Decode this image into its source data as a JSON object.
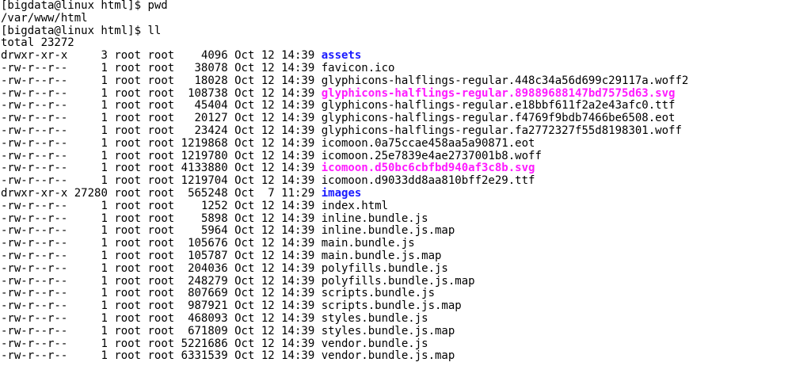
{
  "colors": {
    "background": "#ffffff",
    "text": "#000000",
    "directory": "#1a1aff",
    "svg_file": "#ff1aff"
  },
  "terminal": {
    "prompt_1": "[bigdata@linux html]$ ",
    "command_1": "pwd",
    "output_pwd": "/var/www/html",
    "prompt_2": "[bigdata@linux html]$ ",
    "command_2": "ll",
    "total": "total 23272",
    "entries": [
      {
        "perms": "drwxr-xr-x",
        "links": "3",
        "owner": "root",
        "group": "root",
        "size": "4096",
        "month": "Oct",
        "day": "12",
        "time": "14:39",
        "name": "assets",
        "type": "dir"
      },
      {
        "perms": "-rw-r--r--",
        "links": "1",
        "owner": "root",
        "group": "root",
        "size": "38078",
        "month": "Oct",
        "day": "12",
        "time": "14:39",
        "name": "favicon.ico",
        "type": "regular"
      },
      {
        "perms": "-rw-r--r--",
        "links": "1",
        "owner": "root",
        "group": "root",
        "size": "18028",
        "month": "Oct",
        "day": "12",
        "time": "14:39",
        "name": "glyphicons-halflings-regular.448c34a56d699c29117a.woff2",
        "type": "regular"
      },
      {
        "perms": "-rw-r--r--",
        "links": "1",
        "owner": "root",
        "group": "root",
        "size": "108738",
        "month": "Oct",
        "day": "12",
        "time": "14:39",
        "name": "glyphicons-halflings-regular.89889688147bd7575d63.svg",
        "type": "svg"
      },
      {
        "perms": "-rw-r--r--",
        "links": "1",
        "owner": "root",
        "group": "root",
        "size": "45404",
        "month": "Oct",
        "day": "12",
        "time": "14:39",
        "name": "glyphicons-halflings-regular.e18bbf611f2a2e43afc0.ttf",
        "type": "regular"
      },
      {
        "perms": "-rw-r--r--",
        "links": "1",
        "owner": "root",
        "group": "root",
        "size": "20127",
        "month": "Oct",
        "day": "12",
        "time": "14:39",
        "name": "glyphicons-halflings-regular.f4769f9bdb7466be6508.eot",
        "type": "regular"
      },
      {
        "perms": "-rw-r--r--",
        "links": "1",
        "owner": "root",
        "group": "root",
        "size": "23424",
        "month": "Oct",
        "day": "12",
        "time": "14:39",
        "name": "glyphicons-halflings-regular.fa2772327f55d8198301.woff",
        "type": "regular"
      },
      {
        "perms": "-rw-r--r--",
        "links": "1",
        "owner": "root",
        "group": "root",
        "size": "1219868",
        "month": "Oct",
        "day": "12",
        "time": "14:39",
        "name": "icomoon.0a75ccae458aa5a90871.eot",
        "type": "regular"
      },
      {
        "perms": "-rw-r--r--",
        "links": "1",
        "owner": "root",
        "group": "root",
        "size": "1219780",
        "month": "Oct",
        "day": "12",
        "time": "14:39",
        "name": "icomoon.25e7839e4ae2737001b8.woff",
        "type": "regular"
      },
      {
        "perms": "-rw-r--r--",
        "links": "1",
        "owner": "root",
        "group": "root",
        "size": "4133880",
        "month": "Oct",
        "day": "12",
        "time": "14:39",
        "name": "icomoon.d50bc6cbfbd940af3c8b.svg",
        "type": "svg"
      },
      {
        "perms": "-rw-r--r--",
        "links": "1",
        "owner": "root",
        "group": "root",
        "size": "1219704",
        "month": "Oct",
        "day": "12",
        "time": "14:39",
        "name": "icomoon.d9033dd8aa810bff2e29.ttf",
        "type": "regular"
      },
      {
        "perms": "drwxr-xr-x",
        "links": "27280",
        "owner": "root",
        "group": "root",
        "size": "565248",
        "month": "Oct",
        "day": "7",
        "time": "11:29",
        "name": "images",
        "type": "dir"
      },
      {
        "perms": "-rw-r--r--",
        "links": "1",
        "owner": "root",
        "group": "root",
        "size": "1252",
        "month": "Oct",
        "day": "12",
        "time": "14:39",
        "name": "index.html",
        "type": "regular"
      },
      {
        "perms": "-rw-r--r--",
        "links": "1",
        "owner": "root",
        "group": "root",
        "size": "5898",
        "month": "Oct",
        "day": "12",
        "time": "14:39",
        "name": "inline.bundle.js",
        "type": "regular"
      },
      {
        "perms": "-rw-r--r--",
        "links": "1",
        "owner": "root",
        "group": "root",
        "size": "5964",
        "month": "Oct",
        "day": "12",
        "time": "14:39",
        "name": "inline.bundle.js.map",
        "type": "regular"
      },
      {
        "perms": "-rw-r--r--",
        "links": "1",
        "owner": "root",
        "group": "root",
        "size": "105676",
        "month": "Oct",
        "day": "12",
        "time": "14:39",
        "name": "main.bundle.js",
        "type": "regular"
      },
      {
        "perms": "-rw-r--r--",
        "links": "1",
        "owner": "root",
        "group": "root",
        "size": "105787",
        "month": "Oct",
        "day": "12",
        "time": "14:39",
        "name": "main.bundle.js.map",
        "type": "regular"
      },
      {
        "perms": "-rw-r--r--",
        "links": "1",
        "owner": "root",
        "group": "root",
        "size": "204036",
        "month": "Oct",
        "day": "12",
        "time": "14:39",
        "name": "polyfills.bundle.js",
        "type": "regular"
      },
      {
        "perms": "-rw-r--r--",
        "links": "1",
        "owner": "root",
        "group": "root",
        "size": "248279",
        "month": "Oct",
        "day": "12",
        "time": "14:39",
        "name": "polyfills.bundle.js.map",
        "type": "regular"
      },
      {
        "perms": "-rw-r--r--",
        "links": "1",
        "owner": "root",
        "group": "root",
        "size": "807669",
        "month": "Oct",
        "day": "12",
        "time": "14:39",
        "name": "scripts.bundle.js",
        "type": "regular"
      },
      {
        "perms": "-rw-r--r--",
        "links": "1",
        "owner": "root",
        "group": "root",
        "size": "987921",
        "month": "Oct",
        "day": "12",
        "time": "14:39",
        "name": "scripts.bundle.js.map",
        "type": "regular"
      },
      {
        "perms": "-rw-r--r--",
        "links": "1",
        "owner": "root",
        "group": "root",
        "size": "468093",
        "month": "Oct",
        "day": "12",
        "time": "14:39",
        "name": "styles.bundle.js",
        "type": "regular"
      },
      {
        "perms": "-rw-r--r--",
        "links": "1",
        "owner": "root",
        "group": "root",
        "size": "671809",
        "month": "Oct",
        "day": "12",
        "time": "14:39",
        "name": "styles.bundle.js.map",
        "type": "regular"
      },
      {
        "perms": "-rw-r--r--",
        "links": "1",
        "owner": "root",
        "group": "root",
        "size": "5221686",
        "month": "Oct",
        "day": "12",
        "time": "14:39",
        "name": "vendor.bundle.js",
        "type": "regular"
      },
      {
        "perms": "-rw-r--r--",
        "links": "1",
        "owner": "root",
        "group": "root",
        "size": "6331539",
        "month": "Oct",
        "day": "12",
        "time": "14:39",
        "name": "vendor.bundle.js.map",
        "type": "regular"
      }
    ]
  }
}
